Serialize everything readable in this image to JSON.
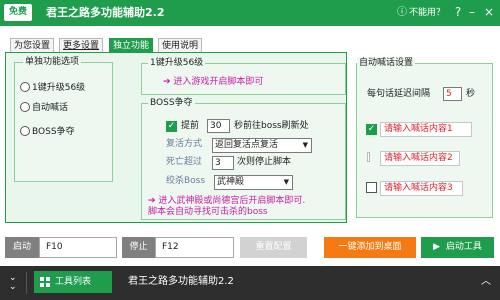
{
  "window": {
    "free_badge": "免费",
    "title": "君王之路多功能辅助2.2",
    "unavailable": "不能用？",
    "icons": {
      "help": "question-icon",
      "minimize": "minimize-icon",
      "close": "close-icon"
    }
  },
  "tabs": [
    {
      "label": "为您设置",
      "active": false
    },
    {
      "label": "更多设置",
      "active": false
    },
    {
      "label": "独立功能",
      "active": true
    },
    {
      "label": "使用说明",
      "active": false
    }
  ],
  "single_group": {
    "title": "单独功能选项",
    "options": [
      "1键升级56级",
      "自动喊话",
      "BOSS争夺"
    ]
  },
  "upgrade_group": {
    "title": "1键升级56级",
    "hint": "进入游戏开启脚本即可"
  },
  "boss_group": {
    "title": "BOSS争夺",
    "advance_label": "提前",
    "advance_seconds": "30",
    "advance_suffix": "秒前往boss刷新处",
    "revive_label": "复活方式",
    "revive_value": "返回复活点复活",
    "death_label": "死亡超过",
    "death_count": "3",
    "death_suffix": "次则停止脚本",
    "boss_label": "绞杀Boss",
    "boss_value": "武神殿",
    "hint_line1": "进入武神殿或尚德宫后开启脚本即可.",
    "hint_line2": "脚本会自动寻找可击杀的boss"
  },
  "auto_group": {
    "title": "自动喊话设置",
    "interval_label": "每句话延迟间隔",
    "interval_value": "5",
    "interval_unit": "秒",
    "messages": [
      {
        "placeholder": "请输入喊话内容1",
        "checked": true
      },
      {
        "placeholder": "请输入喊话内容2",
        "checked": false
      },
      {
        "placeholder": "请输入喊话内容3",
        "checked": false
      }
    ]
  },
  "controls": {
    "start_label": "启动",
    "start_key": "F10",
    "stop_label": "停止",
    "stop_key": "F12",
    "reset_label": "重置配置",
    "shortcut_label": "一键添加到桌面",
    "launch_label": "启动工具",
    "launch_icon": "play-triangle-icon"
  },
  "bottom_bar": {
    "tool_list_label": "工具列表",
    "title": "君王之路多功能辅助2.2",
    "icons": {
      "collapse": "double-chevron-down-icon",
      "expand": "chevron-up-icon",
      "tools": "grid-icon"
    }
  },
  "colors": {
    "accent_green": "#1f9d4d",
    "panel_green": "#e9f6ec",
    "hint_magenta": "#cc1aa8",
    "placeholder_red": "#e0202a",
    "button_orange": "#f57a14",
    "bottom_bar": "#2e2e2e"
  }
}
